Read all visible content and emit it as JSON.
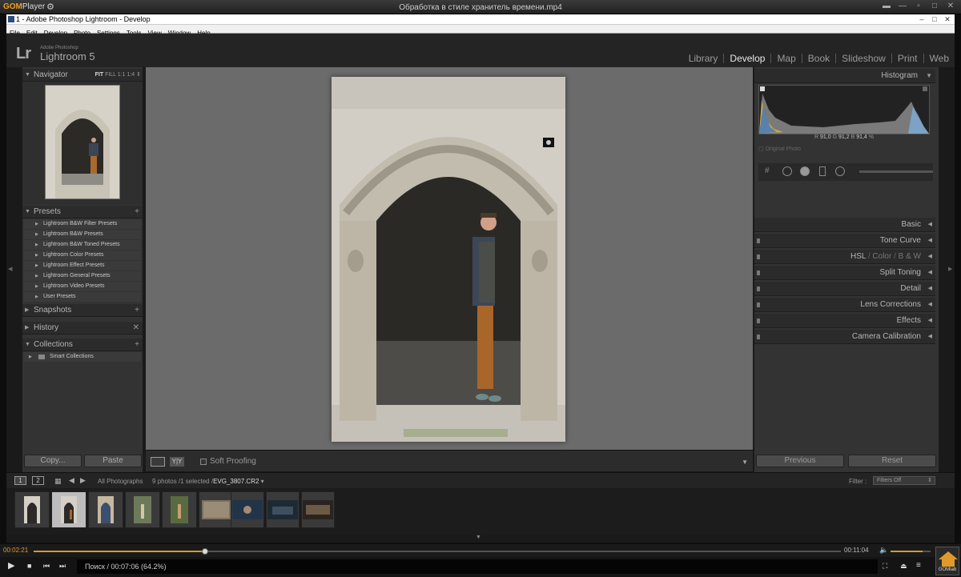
{
  "gom": {
    "logo": "GOM",
    "logo_suffix": "Player",
    "title": "Обработка в стиле хранитель времени.mp4",
    "current_time": "00:02:21",
    "total_time": "00:11:04",
    "status": "Поиск / 00:07:06 (64.2%)",
    "seek_progress_percent": 21.2,
    "lab_label": "GOMlab"
  },
  "window": {
    "title": "1 - Adobe Photoshop Lightroom - Develop",
    "menu": [
      "File",
      "Edit",
      "Develop",
      "Photo",
      "Settings",
      "Tools",
      "View",
      "Window",
      "Help"
    ]
  },
  "lightroom": {
    "logo": "Lr",
    "brand_small": "Adobe Photoshop",
    "brand_name": "Lightroom 5",
    "modules": [
      "Library",
      "Develop",
      "Map",
      "Book",
      "Slideshow",
      "Print",
      "Web"
    ],
    "active_module": "Develop"
  },
  "left_panel": {
    "navigator": {
      "title": "Navigator",
      "zoom_options": [
        "FIT",
        "FILL",
        "1:1",
        "1:4"
      ]
    },
    "presets": {
      "title": "Presets",
      "items": [
        "Lightroom B&W Filter Presets",
        "Lightroom B&W Presets",
        "Lightroom B&W Toned Presets",
        "Lightroom Color Presets",
        "Lightroom Effect Presets",
        "Lightroom General Presets",
        "Lightroom Video Presets",
        "User Presets"
      ]
    },
    "snapshots": {
      "title": "Snapshots"
    },
    "history": {
      "title": "History"
    },
    "collections": {
      "title": "Collections",
      "items": [
        "Smart Collections"
      ]
    },
    "copy_label": "Copy...",
    "paste_label": "Paste"
  },
  "toolbar": {
    "soft_proofing_label": "Soft Proofing"
  },
  "right_panel": {
    "histogram": {
      "title": "Histogram",
      "r_label": "R",
      "r_value": "91,0",
      "g_label": "G",
      "g_value": "91,2",
      "b_label": "B",
      "b_value": "91,4",
      "unit": "%",
      "original_photo_label": "Original Photo"
    },
    "sections": {
      "basic": "Basic",
      "tone_curve": "Tone Curve",
      "hsl": "HSL",
      "hsl_sep1": "/",
      "color": "Color",
      "hsl_sep2": "/",
      "bw": "B & W",
      "split_toning": "Split Toning",
      "detail": "Detail",
      "lens_corrections": "Lens Corrections",
      "effects": "Effects",
      "camera_calibration": "Camera Calibration"
    },
    "previous_label": "Previous",
    "reset_label": "Reset"
  },
  "filmstrip_bar": {
    "page1": "1",
    "page2": "2",
    "source": "All Photographs",
    "count": "9 photos /1 selected /",
    "file": "EVG_3807.CR2",
    "filter_label": "Filter :",
    "filter_value": "Filters Off"
  },
  "colors": {
    "gom_accent": "#e09a2a",
    "lr_bg": "#1a1a1a",
    "panel_bg": "#333333",
    "center_bg": "#6b6b6b"
  }
}
